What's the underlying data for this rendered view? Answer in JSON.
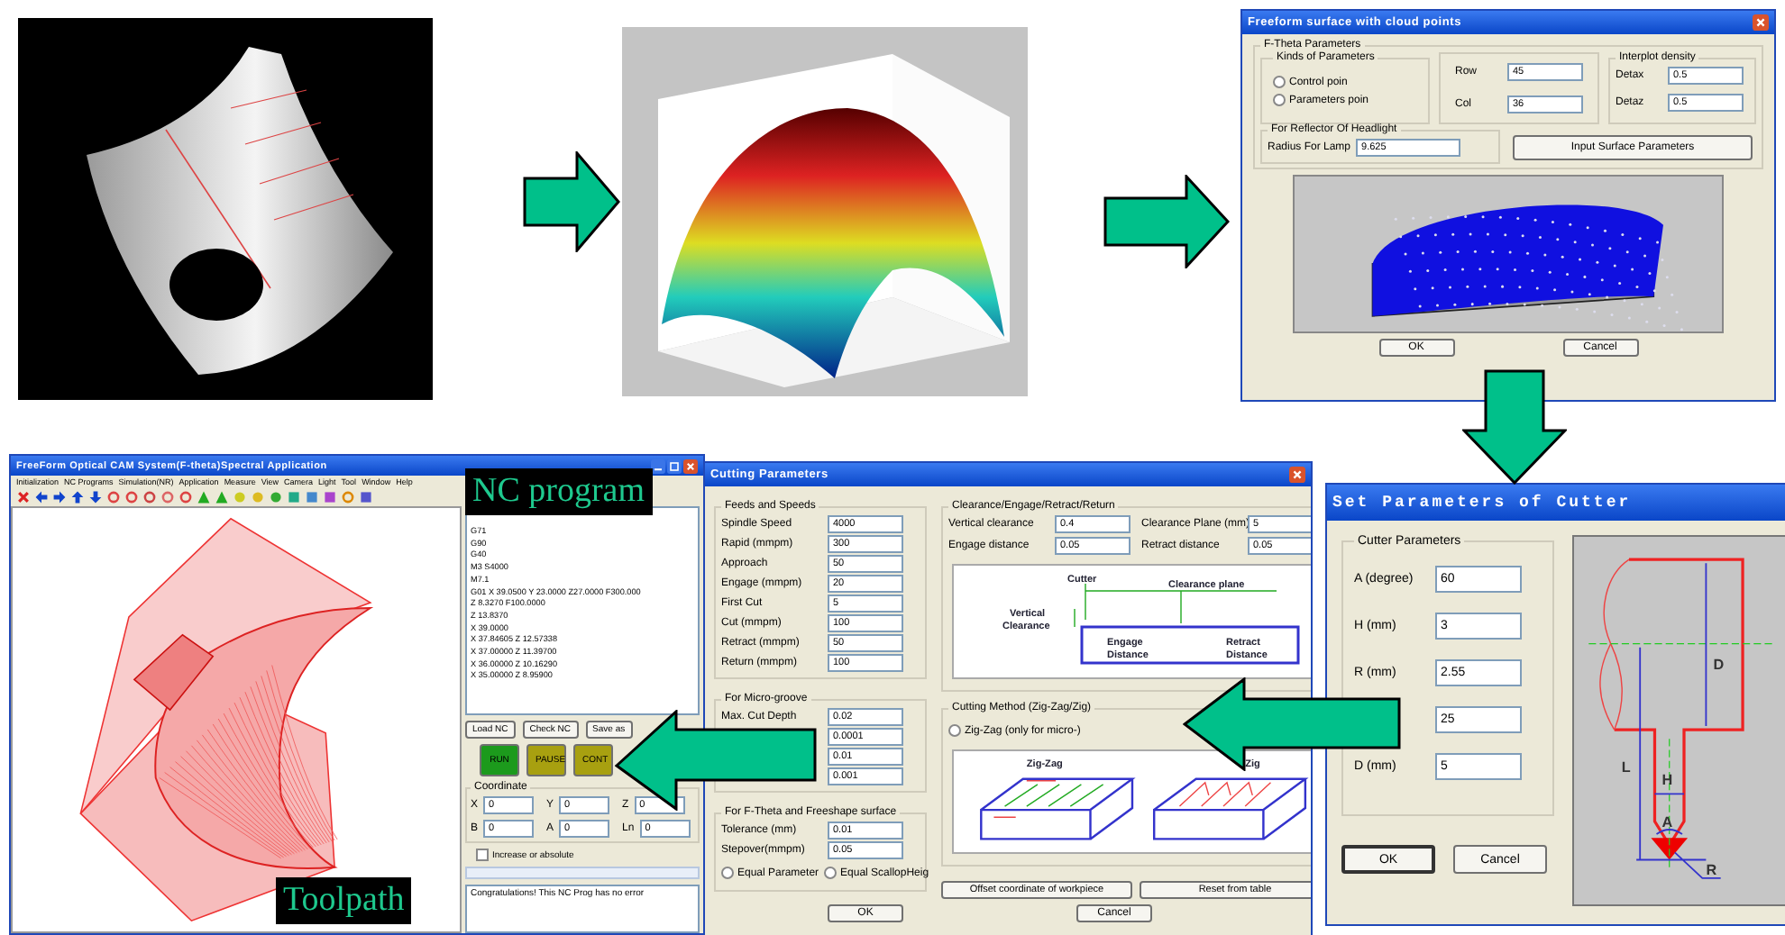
{
  "freeform_dialog": {
    "title": "Freeform surface with cloud points",
    "group_title": "F-Theta Parameters",
    "kinds_title": "Kinds of Parameters",
    "kinds": [
      {
        "label": "Control poin",
        "selected": false
      },
      {
        "label": "Parameters poin",
        "selected": false
      }
    ],
    "grid_fields": [
      {
        "label": "Row",
        "value": "45"
      },
      {
        "label": "Col",
        "value": "36"
      }
    ],
    "density_title": "Interplot density",
    "density_fields": [
      {
        "label": "Detax",
        "value": "0.5"
      },
      {
        "label": "Detaz",
        "value": "0.5"
      }
    ],
    "reflector_title": "For Reflector Of  Headlight",
    "reflector_field": {
      "label": "Radius For Lamp",
      "value": "9.625"
    },
    "input_button": "Input Surface Parameters",
    "buttons": [
      "OK",
      "Cancel"
    ]
  },
  "cutter_dialog": {
    "title": "Set Parameters of Cutter",
    "group_title": "Cutter Parameters",
    "fields": [
      {
        "label": "A (degree)",
        "value": "60"
      },
      {
        "label": "H (mm)",
        "value": "3"
      },
      {
        "label": "R (mm)",
        "value": "2.55"
      },
      {
        "value": "25"
      },
      {
        "label": "D (mm)",
        "value": "5"
      }
    ],
    "buttons": [
      "OK",
      "Cancel"
    ],
    "drawing_labels": [
      "D",
      "L",
      "H",
      "A",
      "R"
    ]
  },
  "cutting_dialog": {
    "title": "Cutting Parameters",
    "feeds_title": "Feeds and Speeds",
    "feeds": [
      {
        "label": "Spindle Speed",
        "value": "4000"
      },
      {
        "label": "Rapid (mmpm)",
        "value": "300"
      },
      {
        "label": "Approach",
        "value": "50"
      },
      {
        "label": "Engage (mmpm)",
        "value": "20"
      },
      {
        "label": "First Cut",
        "value": "5"
      },
      {
        "label": "Cut (mmpm)",
        "value": "100"
      },
      {
        "label": "Retract (mmpm)",
        "value": "50"
      },
      {
        "label": "Return (mmpm)",
        "value": "100"
      }
    ],
    "micro_title": "For Micro-groove",
    "micro": [
      {
        "label": "Max. Cut Depth",
        "value": "0.02"
      },
      {
        "value": "0.0001"
      },
      {
        "value": "0.01"
      },
      {
        "value": "0.001"
      }
    ],
    "freeshape_title": "For F-Theta and Freeshape surface",
    "freeshape": [
      {
        "label": "Tolerance (mm)",
        "value": "0.01"
      },
      {
        "label": "Stepover(mmpm)",
        "value": "0.05"
      }
    ],
    "freeshape_options": [
      {
        "label": "Equal Parameter",
        "selected": false
      },
      {
        "label": "Equal ScallopHeig",
        "selected": false
      }
    ],
    "clearance_title": "Clearance/Engage/Retract/Return",
    "clearance": [
      {
        "label": "Vertical clearance",
        "value": "0.4"
      },
      {
        "label": "Clearance Plane (mm)",
        "value": "5"
      },
      {
        "label": "Engage distance",
        "value": "0.05"
      },
      {
        "label": "Retract distance",
        "value": "0.05"
      }
    ],
    "clearance_labels": [
      "Cutter",
      "Clearance plane",
      "Vertical",
      "Clearance",
      "Engage",
      "Distance",
      "Retract",
      "Distance"
    ],
    "method_title": "Cutting Method (Zig-Zag/Zig)",
    "methods": [
      {
        "label": "Zig-Zag (only for micro-)",
        "selected": false
      }
    ],
    "method_labels": [
      "Zig-Zag",
      "Zig"
    ],
    "action_buttons": [
      "Offset  coordinate of workpiece",
      "Reset from table"
    ],
    "buttons": [
      "OK",
      "Cancel"
    ]
  },
  "cam_window": {
    "title": "FreeForm Optical CAM System(F-theta)Spectral Application",
    "menu": [
      "Initialization",
      "NC Programs",
      "Simulation(NR)",
      "Application",
      "Measure",
      "View",
      "Camera",
      "Light",
      "Tool",
      "Window",
      "Help"
    ],
    "nc_lines": [
      "G71",
      "G90",
      "G40",
      "M3 S4000",
      "M7.1",
      "G01 X 39.0500 Y 23.0000 Z27.0000 F300.000",
      "Z 8.3270 F100.0000",
      "Z 13.8370",
      "X 39.0000",
      "X 37.84605 Z 12.57338",
      "X 37.00000 Z 11.39700",
      "X 36.00000 Z 10.16290",
      "X 35.00000 Z 8.95900"
    ],
    "file_buttons": [
      "Load NC",
      "Check NC",
      "Save as"
    ],
    "run_buttons": [
      {
        "label": "RUN",
        "color": "#1c9a1c"
      },
      {
        "label": "PAUSE",
        "color": "#a8a010"
      },
      {
        "label": "CONT",
        "color": "#a8a010"
      }
    ],
    "coordinate_title": "Coordinate",
    "coordinates": [
      {
        "label": "X",
        "value": "0"
      },
      {
        "label": "Y",
        "value": "0"
      },
      {
        "label": "Z",
        "value": "0"
      },
      {
        "label": "B",
        "value": "0"
      },
      {
        "label": "A",
        "value": "0"
      },
      {
        "label": "Ln",
        "value": "0"
      }
    ],
    "increase_option": {
      "label": "Increase or absolute",
      "checked": false
    },
    "output": "Congratulations! This NC Prog has no error"
  },
  "captions": [
    "NC program",
    "Toolpath"
  ]
}
